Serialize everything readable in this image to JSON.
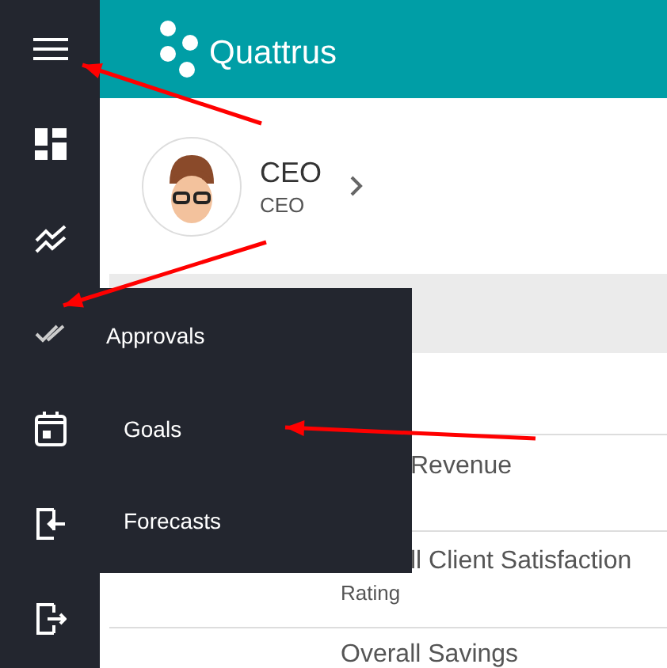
{
  "sidebar": {
    "items": [
      {
        "kind": "menu"
      },
      {
        "kind": "dashboard"
      },
      {
        "kind": "trend"
      },
      {
        "kind": "approvals"
      },
      {
        "kind": "calendar"
      },
      {
        "kind": "login"
      },
      {
        "kind": "logout"
      }
    ]
  },
  "header": {
    "logo": "Quattrus"
  },
  "profile": {
    "name": "CEO",
    "role": "CEO"
  },
  "flyout": {
    "title": "Approvals",
    "items": [
      {
        "label": "Goals"
      },
      {
        "label": "Forecasts"
      }
    ]
  },
  "rows": [
    {
      "title": "Revenue"
    },
    {
      "title": "ll Client Satisfaction",
      "subtitle": "Rating"
    },
    {
      "title": "Overall Savings"
    }
  ],
  "annotations": [
    {
      "kind": "arrow"
    },
    {
      "kind": "arrow"
    },
    {
      "kind": "arrow"
    }
  ]
}
